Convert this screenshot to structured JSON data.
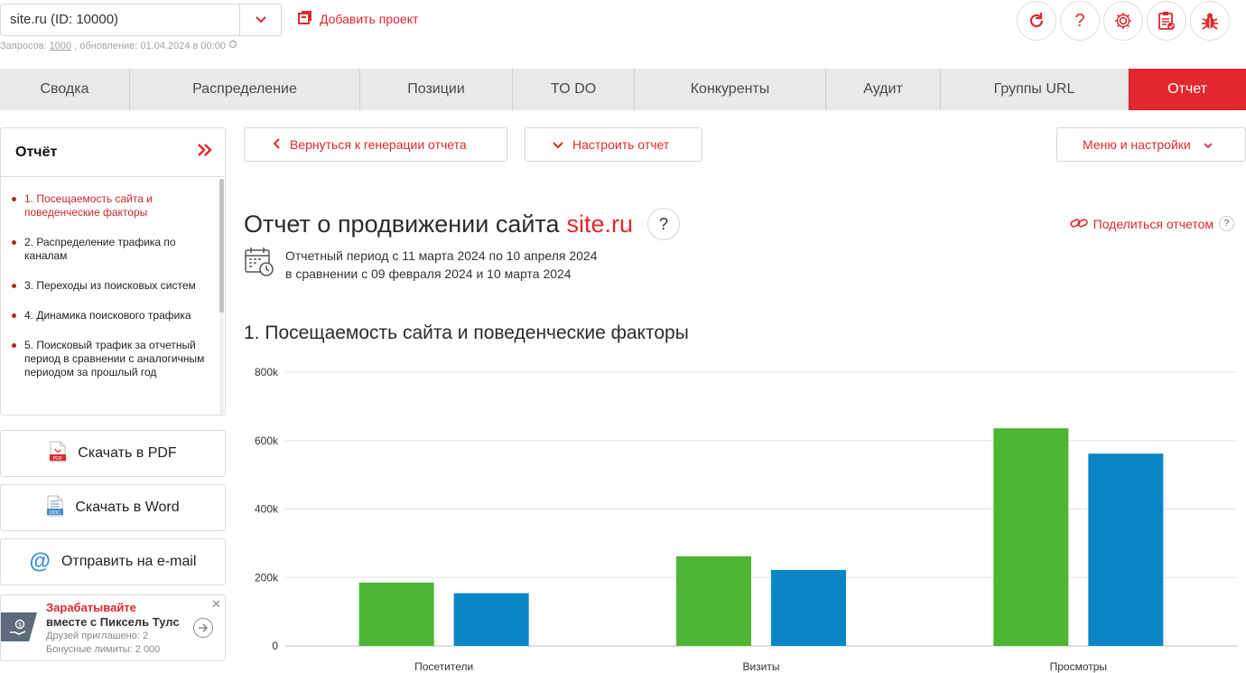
{
  "header": {
    "project_value": "site.ru (ID: 10000)",
    "add_project": "Добавить проект",
    "requests_label": "Запросов:",
    "requests_count": "1000",
    "update_text": ", обновление: 01.04.2024 в 00:00"
  },
  "top_icons": [
    "refresh-icon",
    "help-icon",
    "settings-icon",
    "clipboard-check-icon",
    "bug-icon"
  ],
  "tabs": [
    {
      "label": "Сводка"
    },
    {
      "label": "Распределение"
    },
    {
      "label": "Позиции"
    },
    {
      "label": "TO DO"
    },
    {
      "label": "Конкуренты"
    },
    {
      "label": "Аудит"
    },
    {
      "label": "Группы URL"
    },
    {
      "label": "Отчет"
    }
  ],
  "active_tab": "Отчет",
  "sidebar": {
    "title": "Отчёт",
    "items": [
      {
        "label": "1. Посещаемость сайта и поведенческие факторы"
      },
      {
        "label": "2. Распределение трафика по каналам"
      },
      {
        "label": "3. Переходы из поисковых систем"
      },
      {
        "label": "4. Динамика поискового трафика"
      },
      {
        "label": "5. Поисковый трафик за отчетный период в сравнении с аналогичным периодом за прошлый год"
      }
    ],
    "actions": {
      "pdf": "Скачать в PDF",
      "word": "Скачать в Word",
      "email": "Отправить на e-mail"
    },
    "promo": {
      "line1": "Зарабатывайте",
      "line2": "вместе с Пиксель Тулс",
      "line3": "Друзей приглашено: 2",
      "line4": "Бонусные лимиты: 2 000"
    }
  },
  "buttons": {
    "back": "Вернуться к генерации отчета",
    "configure": "Настроить отчет",
    "menu": "Меню и настройки"
  },
  "report": {
    "title_prefix": "Отчет о продвижении сайта",
    "site": "site.ru",
    "share": "Поделиться отчетом",
    "period_line1": "Отчетный период с 11 марта 2024 по 10 апреля 2024",
    "period_line2": "в сравнении с 09 февраля 2024 и 10 марта 2024",
    "section1_title": "1. Посещаемость сайта и поведенческие факторы"
  },
  "colors": {
    "accent": "#e0282e",
    "series_current": "#4cb531",
    "series_previous": "#0a86c6"
  },
  "chart_data": {
    "type": "bar",
    "categories": [
      "Посетители",
      "Визиты",
      "Просмотры"
    ],
    "series": [
      {
        "values": [
          185000,
          262000,
          636000
        ]
      },
      {
        "values": [
          154000,
          222000,
          562000
        ]
      }
    ],
    "ylim": [
      0,
      800000
    ],
    "yticks": [
      "0",
      "200k",
      "400k",
      "600k",
      "800k"
    ],
    "grid": true
  }
}
